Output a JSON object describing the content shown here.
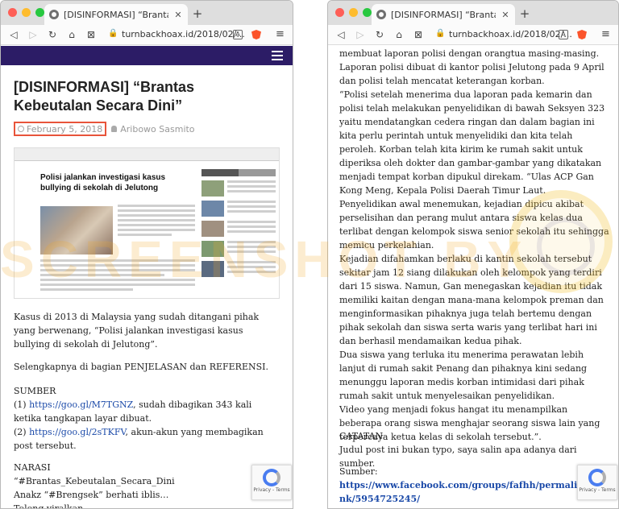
{
  "browser": {
    "tab_title": "[DISINFORMASI] “Brantas Kebeutal",
    "tab_close": "✕",
    "new_tab": "+",
    "url": "turnbackhoax.id/2018/02/...",
    "nav": {
      "back": "◁",
      "forward": "▷",
      "reload": "↻",
      "home": "⌂",
      "bookmark": "⊠",
      "menu": "≡"
    },
    "traffic_lights": [
      "#fe5f57",
      "#febc2e",
      "#28c840"
    ]
  },
  "site": {
    "bar_color": "#2c1c66"
  },
  "article": {
    "title": "[DISINFORMASI] “Brantas Kebeutalan Secara Dini”",
    "date": "February 5, 2018",
    "author": "Aribowo Sasmito",
    "image_headline": "Polisi jalankan investigasi kasus bullying di sekolah di Jelutong",
    "lead": "Kasus di 2013 di Malaysia yang sudah ditangani pihak yang berwenang, “Polisi jalankan investigasi kasus bullying di sekolah di Jelutong”.",
    "more": "Selengkapnya di bagian PENJELASAN dan REFERENSI.",
    "sumber_heading": "SUMBER",
    "sumber1_prefix": "(1) ",
    "sumber1_link": "https://goo.gl/M7TGNZ",
    "sumber1_rest": ", sudah dibagikan 343 kali ketika tangkapan layar dibuat.",
    "sumber2_prefix": "(2) ",
    "sumber2_link": "https://goo.gl/2sTKFV",
    "sumber2_rest": ", akun-akun yang membagikan post tersebut.",
    "narasi_heading": "NARASI",
    "narasi1": "“#Brantas_Kebeutalan_Secara_Dini",
    "narasi2": "Anakz “#Brengsek” berhati iblis…",
    "narasi3": "Tolong viralkan…"
  },
  "article2": {
    "body": "membuat laporan polisi dengan orangtua masing-masing. Laporan polisi dibuat di kantor polisi Jelutong pada 9 April dan polisi telah mencatat keterangan korban.\n“Polisi setelah menerima dua laporan pada kemarin dan polisi telah melakukan penyelidikan di bawah Seksyen 323 yaitu mendatangkan cedera ringan dan dalam bagian ini kita perlu perintah untuk menyelidiki dan kita telah peroleh. Korban telah kita kirim ke rumah sakit untuk diperiksa oleh dokter dan gambar-gambar yang dikatakan menjadi tempat korban dipukul direkam. “Ulas ACP Gan Kong Meng, Kepala Polisi Daerah Timur Laut.\nPenyelidikan awal menemukan, kejadian dipicu akibat perselisihan dan perang mulut antara siswa kelas dua terlibat dengan kelompok siswa senior sekolah itu sehingga memicu perkelahian.\nKejadian difahamkan berlaku di kantin sekolah tersebut sekitar jam 12 siang dilakukan oleh kelompok yang terdiri dari 15 siswa. Namun, Gan menegaskan kejadian itu tidak memiliki kaitan dengan mana-mana kelompok preman dan menginformasikan pihaknya juga telah bertemu dengan pihak sekolah dan siswa serta waris yang terlibat hari ini dan berhasil mendamaikan kedua pihak.\nDua siswa yang terluka itu menerima perawatan lebih lanjut di rumah sakit Penang dan pihaknya kini sedang menunggu laporan medis korban intimidasi dari pihak rumah sakit untuk menyelesaikan penyelidikan.\nVideo yang menjadi fokus hangat itu menampilkan beberapa orang siswa menghajar seorang siswa lain yang terpercaya ketua kelas di sekolah tersebut.”.",
    "catatan_heading": "CATATAN",
    "catatan": "Judul post ini bukan typo, saya salin apa adanya dari sumber.",
    "sumber_label": "Sumber:",
    "sumber_link": "https://www.facebook.com/groups/fafhh/permalink/5954725245/"
  },
  "recaptcha": {
    "text": "Privacy - Terms"
  },
  "watermark": {
    "text": "SCREENSHOT BY"
  }
}
